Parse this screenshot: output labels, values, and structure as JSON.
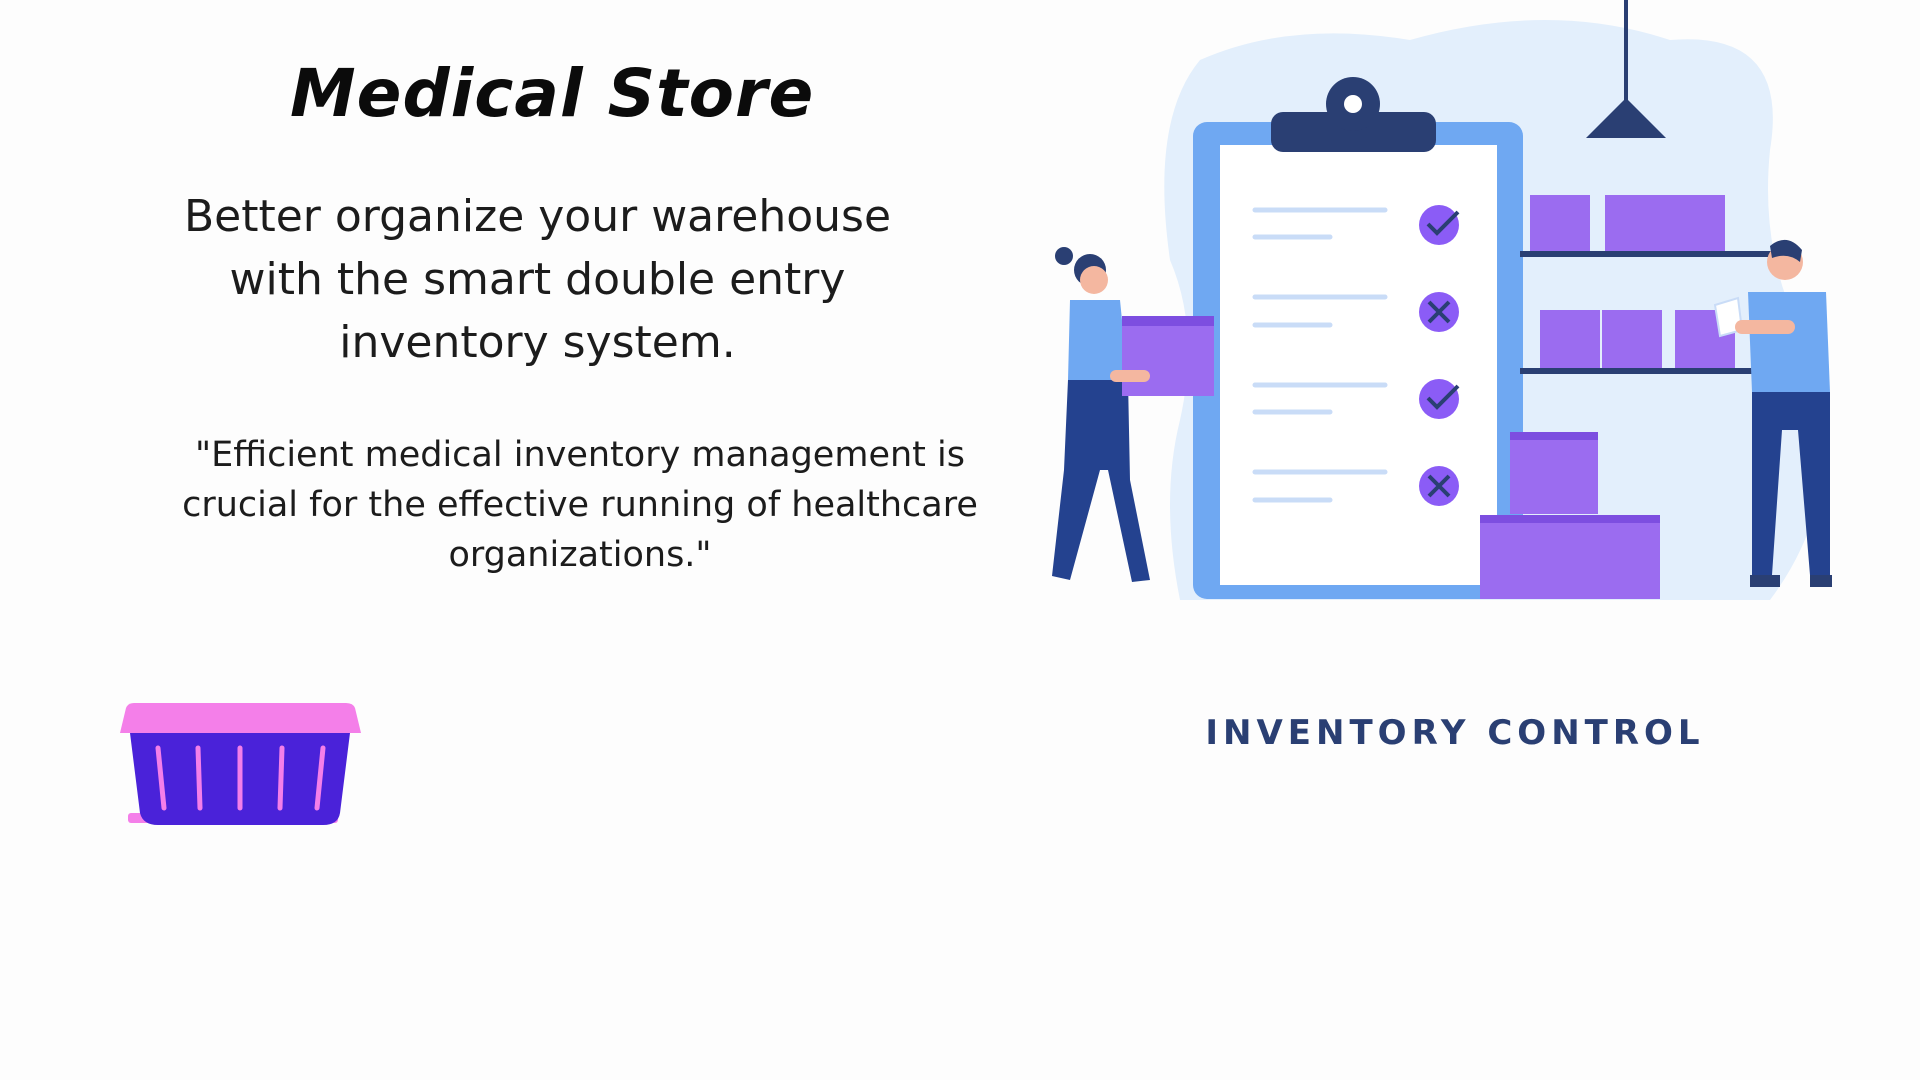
{
  "title": "Medical Store",
  "subtitle": "Better organize your warehouse with the smart double entry inventory system.",
  "quote": "\"Efficient medical inventory management is crucial for the effective running of healthcare organizations.\"",
  "illustration": {
    "caption": "INVENTORY CONTROL",
    "checklist_marks": [
      "check-icon",
      "cross-icon",
      "check-icon",
      "cross-icon"
    ]
  },
  "icons": {
    "basket": "basket-icon"
  },
  "colors": {
    "accent_purple": "#8b5cf6",
    "clipboard_blue": "#6fa8f2",
    "basket_pink": "#f47fe9",
    "basket_body": "#4a22d9",
    "caption_navy": "#2a3f73"
  }
}
